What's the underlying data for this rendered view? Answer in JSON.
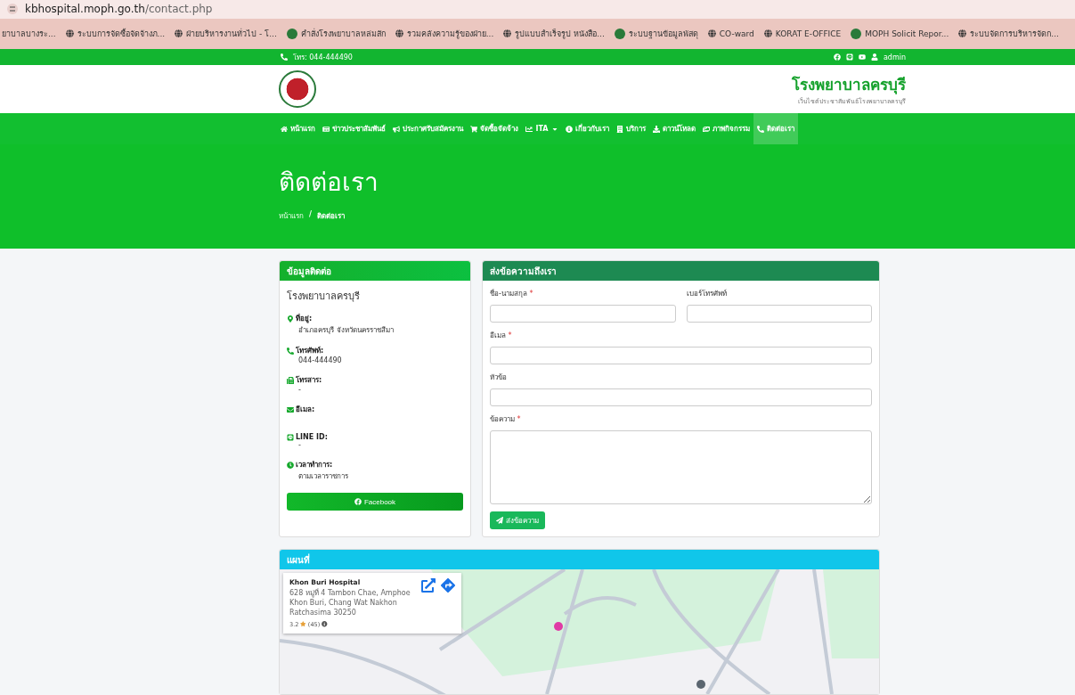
{
  "browser": {
    "url_host": "kbhospital.moph.go.th",
    "url_path": "/contact.php",
    "bookmarks": [
      "ยาบาลบางระ...",
      "ระบบการจัดซื้อจัดจ้างภ...",
      "ฝ่ายบริหารงานทั่วไป - โ...",
      "คำสั่งโรงพยาบาลหล่มสัก",
      "รวมคลังความรู้ของฝ่าย...",
      "รูปแบบสำเร็จรูป หนังสือ...",
      "ระบบฐานข้อมูลพัสดุ",
      "CO-ward",
      "KORAT E-OFFICE",
      "MOPH Solicit Repor...",
      "ระบบจัดการบริหารจัดก..."
    ]
  },
  "topbar": {
    "phone": "โทร: 044-444490",
    "user": "admin"
  },
  "header": {
    "title": "โรงพยาบาลครบุรี",
    "subtitle": "เว็บไซต์ประชาสัมพันธ์โรงพยาบาลครบุรี"
  },
  "nav": [
    {
      "label": "หน้าแรก",
      "selected": false
    },
    {
      "label": "ข่าวประชาสัมพันธ์",
      "selected": false
    },
    {
      "label": "ประกาศรับสมัครงาน",
      "selected": false
    },
    {
      "label": "จัดซื้อจัดจ้าง",
      "selected": false
    },
    {
      "label": "ITA",
      "selected": false,
      "dropdown": true
    },
    {
      "label": "เกี่ยวกับเรา",
      "selected": false
    },
    {
      "label": "บริการ",
      "selected": false
    },
    {
      "label": "ดาวน์โหลด",
      "selected": false
    },
    {
      "label": "ภาพกิจกรรม",
      "selected": false
    },
    {
      "label": "ติดต่อเรา",
      "selected": true
    }
  ],
  "hero": {
    "title": "ติดต่อเรา",
    "breadcrumb": [
      "หน้าแรก",
      "/",
      "ติดต่อเรา"
    ]
  },
  "contact": {
    "title": "ข้อมูลติดต่อ",
    "name": "โรงพยาบาลครบุรี",
    "items": [
      {
        "label": "ที่อยู่:",
        "value": "อำเภอครบุรี จังหวัดนครราชสีมา"
      },
      {
        "label": "โทรศัพท์:",
        "value": "044-444490"
      },
      {
        "label": "โทรสาร:",
        "value": "-"
      },
      {
        "label": "อีเมล:"
      },
      {
        "label": "LINE ID:",
        "value": "-"
      },
      {
        "label": "เวลาทำการ:",
        "value": "ตามเวลาราชการ"
      }
    ],
    "button": "Facebook"
  },
  "form": {
    "title": "ส่งข้อความถึงเรา",
    "rows": [
      [
        {
          "label": "ชื่อ-นามสกุล",
          "required_mark": "*",
          "kind": "input"
        },
        {
          "label": "เบอร์โทรศัพท์",
          "kind": "input"
        }
      ],
      [
        {
          "label": "อีเมล",
          "required_mark": "*",
          "kind": "input"
        }
      ],
      [
        {
          "label": "หัวข้อ",
          "kind": "input"
        }
      ],
      [
        {
          "label": "ข้อความ",
          "required_mark": "*",
          "kind": "textarea"
        }
      ]
    ],
    "submit": "ส่งข้อความ"
  },
  "map": {
    "title": "แผนที่",
    "place": {
      "name": "Khon Buri Hospital",
      "address": "628 หมู่ที่ 4 Tambon Chae, Amphoe Khon Buri, Chang Wat Nakhon Ratchasima 30250",
      "rating": "3.2",
      "reviews": "(45)"
    }
  }
}
